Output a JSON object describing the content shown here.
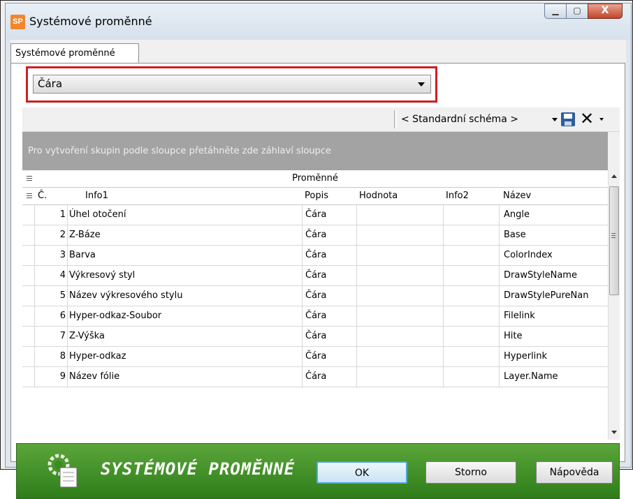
{
  "window": {
    "icon_text": "SP",
    "title": "Systémové proměnné",
    "controls": {
      "minimize": "▁",
      "maximize": "▢",
      "close": "X"
    }
  },
  "tab": {
    "label": "Systémové proměnné"
  },
  "object_select": {
    "value": "Čára"
  },
  "toolbar": {
    "scheme": "< Standardní schéma >",
    "delete_glyph": "✕"
  },
  "grid": {
    "group_hint": "Pro vytvoření skupin podle sloupce přetáhněte zde záhlaví sloupce",
    "band": "Proměnné",
    "columns": [
      "Č.",
      "Info1",
      "Popis",
      "Hodnota",
      "Info2",
      "Název"
    ],
    "rows": [
      {
        "no": "1",
        "info1": "Úhel otočení",
        "popis": "Čára",
        "hodnota": "",
        "info2": "",
        "nazev": "Angle"
      },
      {
        "no": "2",
        "info1": "Z-Báze",
        "popis": "Čára",
        "hodnota": "",
        "info2": "",
        "nazev": "Base"
      },
      {
        "no": "3",
        "info1": "Barva",
        "popis": "Čára",
        "hodnota": "",
        "info2": "",
        "nazev": "ColorIndex"
      },
      {
        "no": "4",
        "info1": "Výkresový styl",
        "popis": "Čára",
        "hodnota": "",
        "info2": "",
        "nazev": "DrawStyleName"
      },
      {
        "no": "5",
        "info1": "Název výkresového stylu",
        "popis": "Čára",
        "hodnota": "",
        "info2": "",
        "nazev": "DrawStylePureNan"
      },
      {
        "no": "6",
        "info1": "Hyper-odkaz-Soubor",
        "popis": "Čára",
        "hodnota": "",
        "info2": "",
        "nazev": "Filelink"
      },
      {
        "no": "7",
        "info1": "Z-Výška",
        "popis": "Čára",
        "hodnota": "",
        "info2": "",
        "nazev": "Hite"
      },
      {
        "no": "8",
        "info1": "Hyper-odkaz",
        "popis": "Čára",
        "hodnota": "",
        "info2": "",
        "nazev": "Hyperlink"
      },
      {
        "no": "9",
        "info1": "Název fólie",
        "popis": "Čára",
        "hodnota": "",
        "info2": "",
        "nazev": "Layer.Name"
      }
    ]
  },
  "footer": {
    "title": "SYSTÉMOVÉ PROMĚNNÉ",
    "ok_label": "OK",
    "cancel_label": "Storno",
    "help_label": "Nápověda"
  },
  "colors": {
    "accent_red": "#cc1f24",
    "footer_green": "#3f8f25",
    "group_bar": "#a3a3a3"
  }
}
